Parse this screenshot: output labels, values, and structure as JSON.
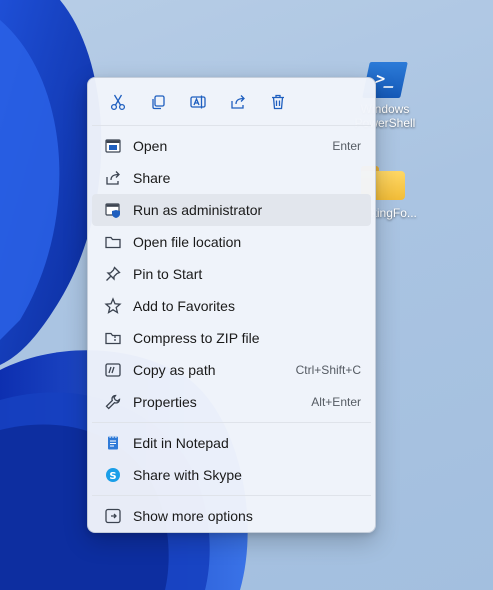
{
  "desktop": {
    "powershell_label_line1": "Windows",
    "powershell_label_line2": "PowerShell",
    "folder_label": "WorkingFo..."
  },
  "toolbar": {
    "icons": [
      "cut-icon",
      "copy-icon",
      "rename-icon",
      "share-icon",
      "delete-icon"
    ]
  },
  "menu": {
    "items": [
      {
        "label": "Open",
        "shortcut": "Enter"
      },
      {
        "label": "Share",
        "shortcut": ""
      },
      {
        "label": "Run as administrator",
        "shortcut": ""
      },
      {
        "label": "Open file location",
        "shortcut": ""
      },
      {
        "label": "Pin to Start",
        "shortcut": ""
      },
      {
        "label": "Add to Favorites",
        "shortcut": ""
      },
      {
        "label": "Compress to ZIP file",
        "shortcut": ""
      },
      {
        "label": "Copy as path",
        "shortcut": "Ctrl+Shift+C"
      },
      {
        "label": "Properties",
        "shortcut": "Alt+Enter"
      }
    ],
    "apps": [
      {
        "label": "Edit in Notepad"
      },
      {
        "label": "Share with Skype"
      }
    ],
    "more": {
      "label": "Show more options"
    }
  },
  "colors": {
    "accent": "#1f5fbf",
    "icon_stroke": "#3b4350",
    "hover_bg": "#e2e6ed"
  }
}
